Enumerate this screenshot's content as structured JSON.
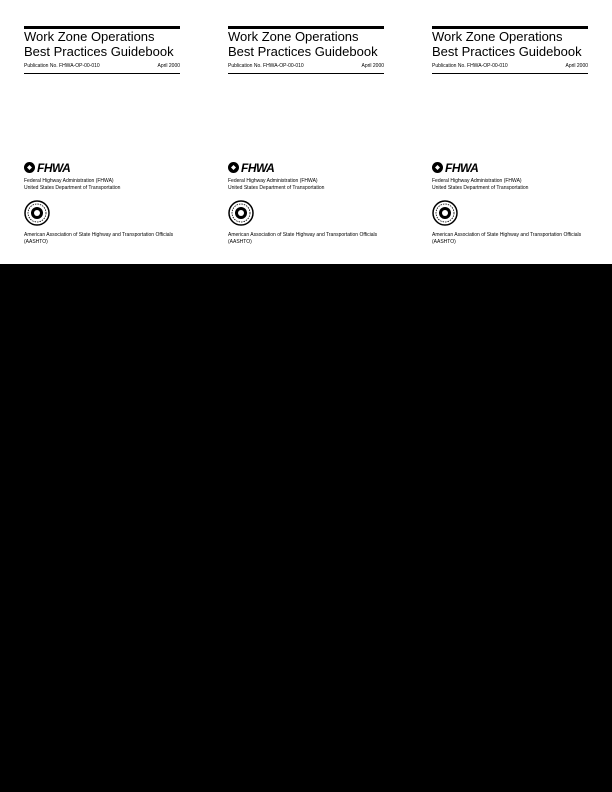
{
  "covers": [
    {
      "title_line1": "Work Zone Operations",
      "title_line2": "Best Practices Guidebook",
      "publication_no": "Publication No. FHWA-OP-00-010",
      "date": "April 2000",
      "fhwa_logo_text": "FHWA",
      "agency_line1": "Federal Highway Administration (FHWA)",
      "agency_line2": "United States Department of Transportation",
      "assoc_line1": "American Association of State Highway and Transportation Officials",
      "assoc_line2": "(AASHTO)"
    },
    {
      "title_line1": "Work Zone Operations",
      "title_line2": "Best Practices Guidebook",
      "publication_no": "Publication No. FHWA-OP-00-010",
      "date": "April 2000",
      "fhwa_logo_text": "FHWA",
      "agency_line1": "Federal Highway Administration (FHWA)",
      "agency_line2": "United States Department of Transportation",
      "assoc_line1": "American Association of State Highway and Transportation Officials",
      "assoc_line2": "(AASHTO)"
    },
    {
      "title_line1": "Work Zone Operations",
      "title_line2": "Best Practices Guidebook",
      "publication_no": "Publication No. FHWA-OP-00-010",
      "date": "April 2000",
      "fhwa_logo_text": "FHWA",
      "agency_line1": "Federal Highway Administration (FHWA)",
      "agency_line2": "United States Department of Transportation",
      "assoc_line1": "American Association of State Highway and Transportation Officials",
      "assoc_line2": "(AASHTO)"
    }
  ],
  "icons": {
    "fhwa_logo": "fhwa-shield-icon",
    "aashto_seal": "aashto-seal-icon"
  },
  "colors": {
    "page_background": "#ffffff",
    "canvas_background": "#000000",
    "text": "#000000"
  }
}
